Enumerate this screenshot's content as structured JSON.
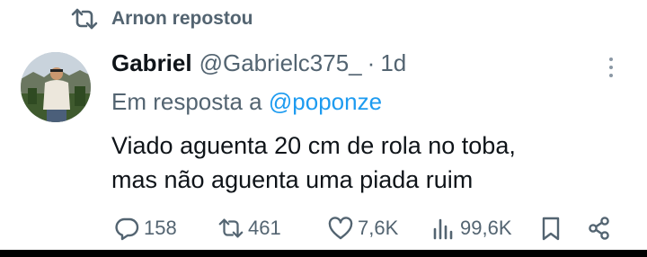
{
  "repost": {
    "label": "Arnon repostou"
  },
  "tweet": {
    "author_name": "Gabriel",
    "author_handle": "@Gabrielc375_",
    "separator": "·",
    "time": "1d",
    "reply_prefix": "Em resposta a",
    "reply_mention": "@poponze",
    "text_line1": "Viado aguenta 20 cm de rola no toba,",
    "text_line2": "mas não aguenta uma piada ruim"
  },
  "actions": {
    "replies": "158",
    "reposts": "461",
    "likes": "7,6K",
    "views": "99,6K"
  },
  "icons": {
    "repost": "repost-icon",
    "reply": "reply-icon",
    "like": "heart-icon",
    "views": "views-icon",
    "bookmark": "bookmark-icon",
    "share": "share-icon",
    "more": "more-icon"
  },
  "colors": {
    "text": "#0f1419",
    "secondary": "#536471",
    "link": "#1d9bf0"
  }
}
